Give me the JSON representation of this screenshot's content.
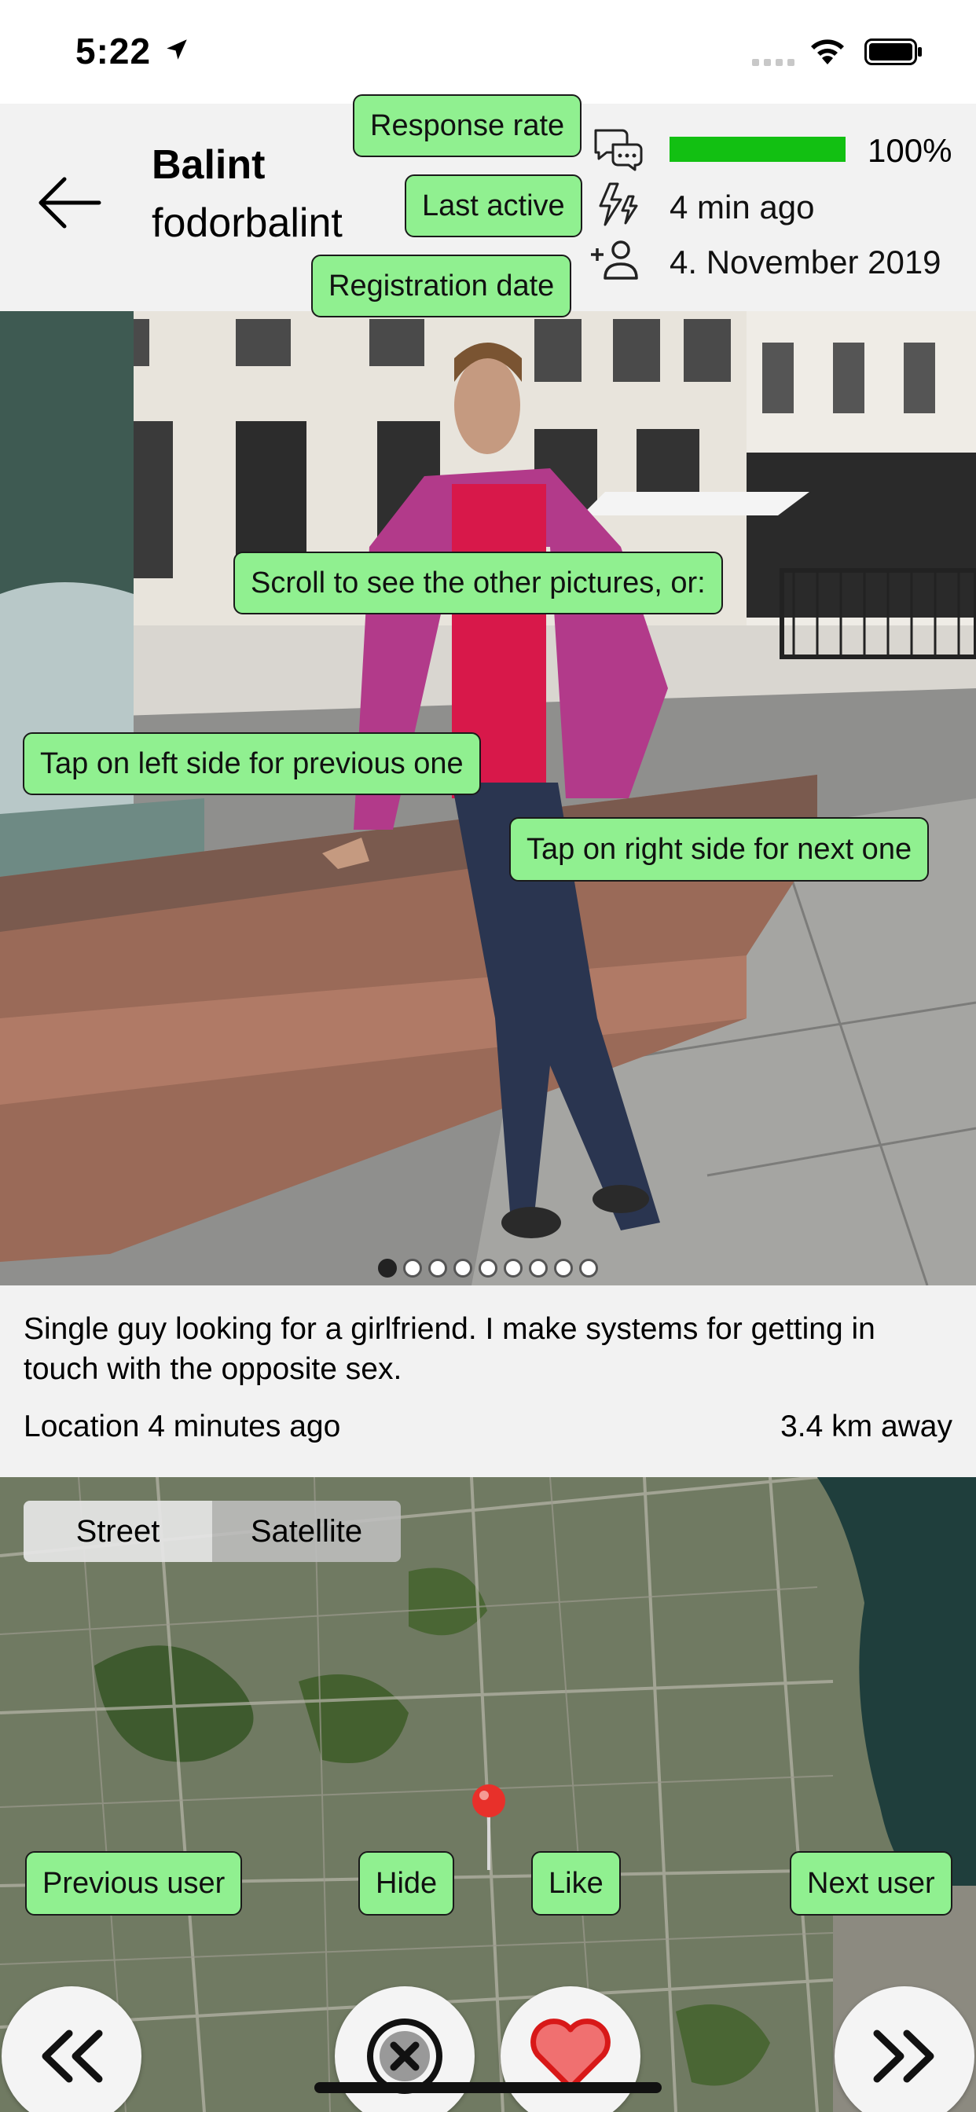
{
  "status_bar": {
    "time": "5:22",
    "icons": [
      "location-arrow-icon",
      "signal-icon",
      "wifi-icon",
      "battery-icon"
    ]
  },
  "header": {
    "back_icon": "arrow-left-icon",
    "name": "Balint",
    "username": "fodorbalint",
    "stats": {
      "response_rate": {
        "icon": "chat-bubbles-icon",
        "value": "100%",
        "fill_fraction": 1.0,
        "fill_color": "#12c012"
      },
      "last_active": {
        "icon": "lightning-icon",
        "value": "4 min ago"
      },
      "registration": {
        "icon": "add-person-icon",
        "value": "4. November 2019"
      }
    }
  },
  "photo": {
    "total": 9,
    "current_index": 0
  },
  "description": {
    "text": "Single guy looking for a girlfriend. I make systems for getting in touch with the opposite sex.",
    "location_time": "Location 4 minutes ago",
    "distance": "3.4 km away"
  },
  "map": {
    "toggle": {
      "street": "Street",
      "satellite": "Satellite",
      "selected": "Satellite"
    },
    "pin_icon": "map-pin-icon",
    "pin_color": "#e8302a"
  },
  "actions": {
    "previous_icon": "double-chevron-left-icon",
    "hide_icon": "close-circle-icon",
    "like_icon": "heart-icon",
    "like_color": "#f07070",
    "next_icon": "double-chevron-right-icon"
  },
  "tooltips": {
    "response_rate": "Response rate",
    "last_active": "Last active",
    "registration_date": "Registration date",
    "scroll": "Scroll to see the other pictures, or:",
    "tap_left": "Tap on left side for previous one",
    "tap_right": "Tap on right side for next one",
    "previous_user": "Previous user",
    "hide": "Hide",
    "like": "Like",
    "next_user": "Next user",
    "color": "#90f090"
  }
}
